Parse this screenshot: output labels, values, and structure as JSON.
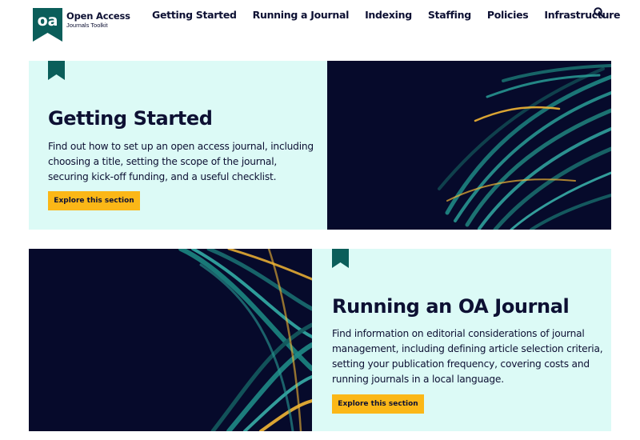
{
  "logo": {
    "mark_text": "oa",
    "title": "Open Access",
    "subtitle": "Journals Toolkit"
  },
  "nav": {
    "items": [
      {
        "label": "Getting Started"
      },
      {
        "label": "Running a Journal"
      },
      {
        "label": "Indexing"
      },
      {
        "label": "Staffing"
      },
      {
        "label": "Policies"
      },
      {
        "label": "Infrastructure"
      }
    ],
    "search_icon": "search-icon"
  },
  "sections": [
    {
      "title": "Getting Started",
      "description": "Find out how to set up an open access journal, including choosing a title, setting the scope of the journal, securing kick-off funding, and a useful checklist.",
      "cta": "Explore this section"
    },
    {
      "title": "Running an OA Journal",
      "description": "Find information on editorial considerations of journal management, including defining article selection criteria, setting your publication frequency, covering costs and running journals in a local language.",
      "cta": "Explore this section"
    }
  ],
  "colors": {
    "brand_teal": "#0b5e5a",
    "card_bg": "#dcfaf6",
    "navy": "#060a2b",
    "accent_yellow": "#fbb717",
    "text": "#0d1033"
  }
}
